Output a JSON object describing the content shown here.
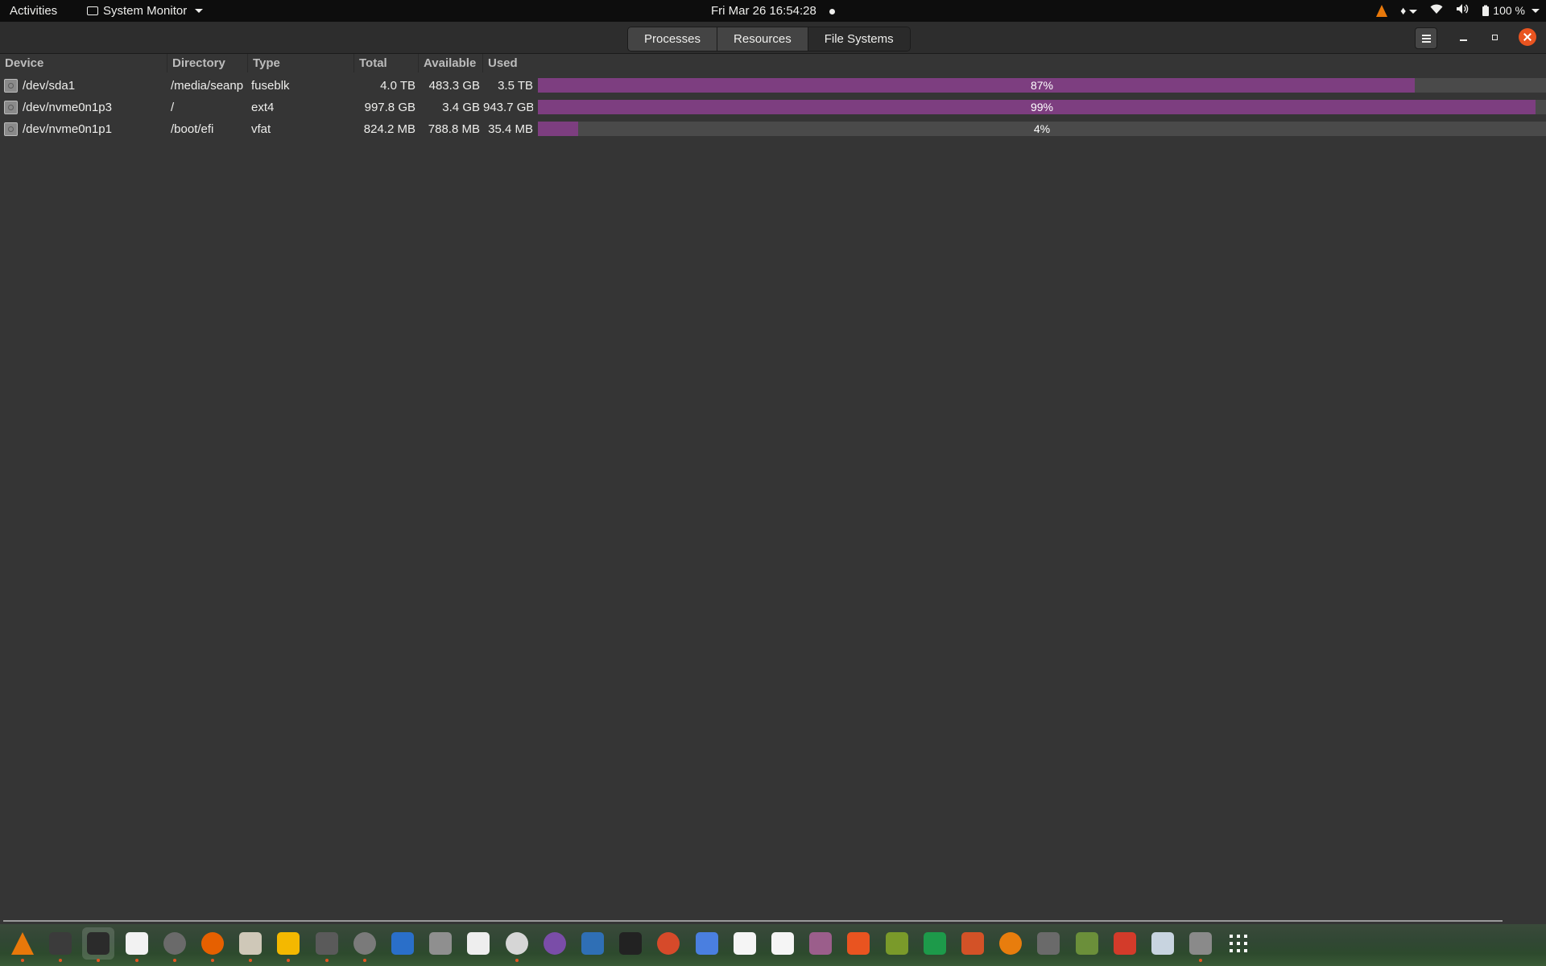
{
  "topbar": {
    "activities": "Activities",
    "app_name": "System Monitor",
    "clock": "Fri Mar 26  16:54:28",
    "battery": "100 %"
  },
  "tabs": [
    {
      "label": "Processes",
      "active": false
    },
    {
      "label": "Resources",
      "active": false
    },
    {
      "label": "File Systems",
      "active": true
    }
  ],
  "table": {
    "headers": [
      "Device",
      "Directory",
      "Type",
      "Total",
      "Available",
      "Used"
    ],
    "rows": [
      {
        "device": "/dev/sda1",
        "directory": "/media/seanp",
        "type": "fuseblk",
        "total": "4.0 TB",
        "available": "483.3 GB",
        "used": "3.5 TB",
        "percent": 87,
        "percent_label": "87%"
      },
      {
        "device": "/dev/nvme0n1p3",
        "directory": "/",
        "type": "ext4",
        "total": "997.8 GB",
        "available": "3.4 GB",
        "used": "943.7 GB",
        "percent": 99,
        "percent_label": "99%"
      },
      {
        "device": "/dev/nvme0n1p1",
        "directory": "/boot/efi",
        "type": "vfat",
        "total": "824.2 MB",
        "available": "788.8 MB",
        "used": "35.4 MB",
        "percent": 4,
        "percent_label": "4%"
      }
    ]
  },
  "colors": {
    "bar_fill": "#7d3e80",
    "bar_track": "#4a4a4a",
    "close_button": "#e95420",
    "accent": "#e95420"
  },
  "dock": {
    "items": [
      {
        "name": "vlc-icon",
        "color": "#e8780a",
        "running": true
      },
      {
        "name": "terminal-icon",
        "color": "#3b3b3b",
        "running": true
      },
      {
        "name": "system-monitor-icon",
        "color": "#2b2b2b",
        "running": true,
        "active": true
      },
      {
        "name": "text-editor-icon",
        "color": "#f2f2f2",
        "running": true
      },
      {
        "name": "clock-icon",
        "color": "#6a6a6a",
        "running": true
      },
      {
        "name": "firefox-icon",
        "color": "#e66000",
        "running": true
      },
      {
        "name": "files-icon",
        "color": "#cfc8b8",
        "running": true
      },
      {
        "name": "calculator-icon",
        "color": "#f4b800",
        "running": true
      },
      {
        "name": "puzzle-icon",
        "color": "#5a5a5a",
        "running": true
      },
      {
        "name": "settings-icon",
        "color": "#7a7a7a",
        "running": true
      },
      {
        "name": "writer-icon",
        "color": "#2a6fc9",
        "running": false
      },
      {
        "name": "image-viewer-icon",
        "color": "#8f8f8f",
        "running": false
      },
      {
        "name": "power-statistics-icon",
        "color": "#eeeeee",
        "running": false
      },
      {
        "name": "software-updater-icon",
        "color": "#d6d6d6",
        "running": true
      },
      {
        "name": "cheese-icon",
        "color": "#7a4da8",
        "running": false
      },
      {
        "name": "virtualbox-icon",
        "color": "#2f6fb5",
        "running": false
      },
      {
        "name": "inkscape-icon",
        "color": "#222222",
        "running": false
      },
      {
        "name": "headphones-icon",
        "color": "#d64a2a",
        "running": false
      },
      {
        "name": "screenshot-icon",
        "color": "#4a7fe0",
        "running": false
      },
      {
        "name": "character-map-icon",
        "color": "#f5f5f5",
        "running": false
      },
      {
        "name": "typora-icon",
        "color": "#f5f5f5",
        "running": false
      },
      {
        "name": "tweaks-icon",
        "color": "#9b5e8b",
        "running": false
      },
      {
        "name": "app-store-icon",
        "color": "#e95420",
        "running": false
      },
      {
        "name": "gimp-icon",
        "color": "#7a9a2a",
        "running": false
      },
      {
        "name": "calc-icon",
        "color": "#1d9a4a",
        "running": false
      },
      {
        "name": "impress-icon",
        "color": "#d35227",
        "running": false
      },
      {
        "name": "blender-icon",
        "color": "#e87d0d",
        "running": false
      },
      {
        "name": "gimp-wilber-icon",
        "color": "#6a6a6a",
        "running": false
      },
      {
        "name": "minecraft-icon",
        "color": "#6b8f3a",
        "running": false
      },
      {
        "name": "mario-icon",
        "color": "#d33b2a",
        "running": false
      },
      {
        "name": "scanner-icon",
        "color": "#c8d4e0",
        "running": false
      },
      {
        "name": "usb-drive-icon",
        "color": "#8a8a8a",
        "running": true
      },
      {
        "name": "show-apps-icon",
        "color": "#ffffff",
        "running": false
      }
    ]
  }
}
